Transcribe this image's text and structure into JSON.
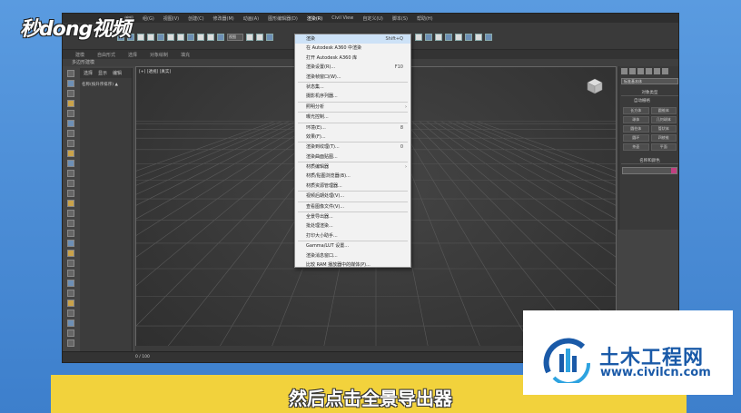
{
  "watermark_top_left": "秒dong视频",
  "menubar": {
    "items": [
      "编辑",
      "组(G)",
      "视图(V)",
      "创建(C)",
      "修改器(M)",
      "动画(A)",
      "图形编辑器(D)",
      "渲染(R)",
      "Civil View",
      "自定义(U)",
      "脚本(S)",
      "帮助(H)"
    ]
  },
  "toolbar": {
    "view_dropdown": "视图"
  },
  "ribbon": {
    "tabs": [
      "建模",
      "自由形式",
      "选择",
      "对象绘制",
      "填充"
    ],
    "sub_label": "多边形建模"
  },
  "scene_explorer": {
    "tabs": [
      "选择",
      "显示",
      "编辑"
    ],
    "header": "名称(按升序排序) ▲"
  },
  "viewport": {
    "label": "[+] [透视] [真实]"
  },
  "render_menu": {
    "items": [
      {
        "label": "渲染",
        "shortcut": "Shift+Q",
        "highlight": true
      },
      {
        "label": "在 Autodesk A360 中渲染",
        "shortcut": ""
      },
      {
        "label": "打开 Autodesk A360 库",
        "shortcut": ""
      },
      {
        "label": "渲染设置(R)...",
        "shortcut": "F10"
      },
      {
        "label": "渲染帧窗口(W)...",
        "shortcut": ""
      },
      {
        "sep": true
      },
      {
        "label": "状态集...",
        "shortcut": ""
      },
      {
        "label": "摄影机序列器...",
        "shortcut": ""
      },
      {
        "sep": true
      },
      {
        "label": "照明分析",
        "shortcut": "",
        "submenu": true
      },
      {
        "sep": true
      },
      {
        "label": "曝光控制...",
        "shortcut": ""
      },
      {
        "sep": true
      },
      {
        "label": "环境(E)...",
        "shortcut": "8"
      },
      {
        "label": "效果(F)...",
        "shortcut": ""
      },
      {
        "sep": true
      },
      {
        "label": "渲染到纹理(T)...",
        "shortcut": "0"
      },
      {
        "label": "渲染曲面贴图...",
        "shortcut": ""
      },
      {
        "sep": true
      },
      {
        "label": "材质编辑器",
        "shortcut": "",
        "submenu": true
      },
      {
        "label": "材质/贴图浏览器(B)...",
        "shortcut": ""
      },
      {
        "label": "材质资源管理器...",
        "shortcut": ""
      },
      {
        "sep": true
      },
      {
        "label": "视频后期处理(V)...",
        "shortcut": ""
      },
      {
        "sep": true
      },
      {
        "label": "查看图像文件(V)...",
        "shortcut": ""
      },
      {
        "sep": true
      },
      {
        "label": "全景导出器...",
        "shortcut": ""
      },
      {
        "label": "批处理渲染...",
        "shortcut": ""
      },
      {
        "label": "打印大小助手...",
        "shortcut": ""
      },
      {
        "sep": true
      },
      {
        "label": "Gamma/LUT 设置...",
        "shortcut": ""
      },
      {
        "label": "渲染消息窗口...",
        "shortcut": ""
      },
      {
        "label": "比较 RAM 播放器中的媒体(P)...",
        "shortcut": ""
      }
    ]
  },
  "command_panel": {
    "dropdown": "标准基本体",
    "section_title": "对象类型",
    "autogrid": "自动栅格",
    "buttons": [
      "长方体",
      "圆锥体",
      "球体",
      "几何球体",
      "圆柱体",
      "管状体",
      "圆环",
      "四棱锥",
      "茶壶",
      "平面"
    ],
    "name_color_title": "名称和颜色"
  },
  "status": {
    "frame": "0 / 100"
  },
  "caption": "然后点击全景导出器",
  "watermark_br": {
    "cn": "土木工程网",
    "en": "www.civilcn.com"
  },
  "colors": {
    "caption_bg": "#f2d23c",
    "menu_highlight": "#cde2f7",
    "brand_blue": "#1a5aa8"
  }
}
